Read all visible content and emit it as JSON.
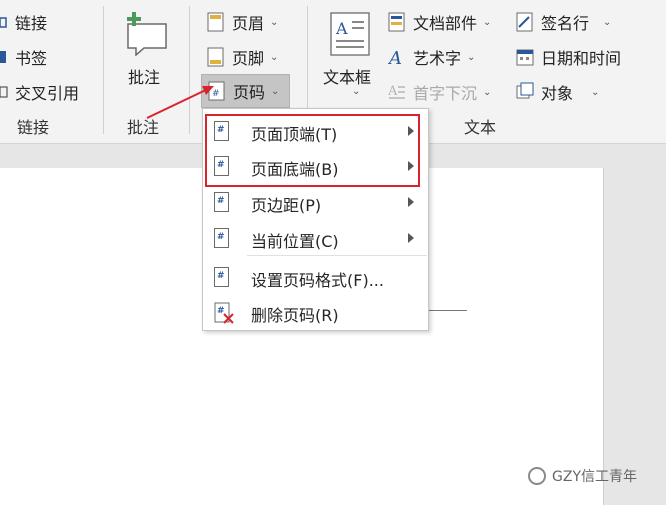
{
  "ribbon": {
    "link_group": {
      "items": [
        "链接",
        "书签",
        "交叉引用"
      ],
      "label": "链接"
    },
    "comment_group": {
      "button": "批注",
      "label": "批注"
    },
    "header_footer_group": {
      "items": [
        "页眉",
        "页脚",
        "页码"
      ]
    },
    "text_group": {
      "textbox": "文本框",
      "doc_parts": "文档部件",
      "wordart": "艺术字",
      "dropcap": "首字下沉",
      "signature": "签名行",
      "datetime": "日期和时间",
      "object": "对象",
      "label": "文本"
    }
  },
  "page_number_menu": {
    "items": [
      {
        "label": "页面顶端(T)",
        "submenu": true
      },
      {
        "label": "页面底端(B)",
        "submenu": true
      },
      {
        "label": "页边距(P)",
        "submenu": true
      },
      {
        "label": "当前位置(C)",
        "submenu": true
      },
      {
        "label": "设置页码格式(F)...",
        "submenu": false
      },
      {
        "label": "删除页码(R)",
        "submenu": false
      }
    ]
  },
  "watermark": "GZY信工青年",
  "colors": {
    "highlight": "#d9232d",
    "ribbon_bg": "#f3f3f3",
    "accent_blue": "#2b579a",
    "comment_green": "#4a9a5a"
  }
}
